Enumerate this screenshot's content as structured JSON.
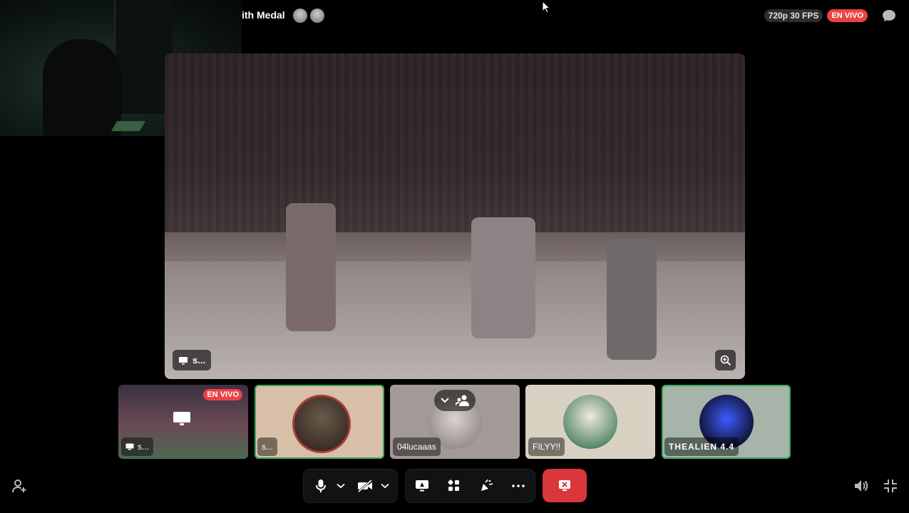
{
  "header": {
    "title": "ith Medal",
    "quality": "720p 30 FPS",
    "live_badge": "EN VIVO"
  },
  "stage": {
    "label": "s...",
    "icons": {
      "screen": "screen-share-icon",
      "zoom": "zoom-icon"
    }
  },
  "tiles": [
    {
      "name": "s...",
      "live": "EN VIVO",
      "type": "stream"
    },
    {
      "name": "s...",
      "type": "user"
    },
    {
      "name": "04lucaaas",
      "type": "user"
    },
    {
      "name": "FILYY!!",
      "type": "user"
    },
    {
      "name": "THEALIEN 4.4",
      "type": "user"
    }
  ],
  "controls": {
    "icons": [
      "microphone-icon",
      "chevron-down-icon",
      "camera-off-icon",
      "chevron-down-icon",
      "screen-share-icon",
      "activities-icon",
      "soundboard-icon",
      "more-icon",
      "disconnect-icon"
    ]
  },
  "colors": {
    "live": "#ed4245",
    "speaking": "#3ba55d",
    "hangup": "#da373c"
  }
}
